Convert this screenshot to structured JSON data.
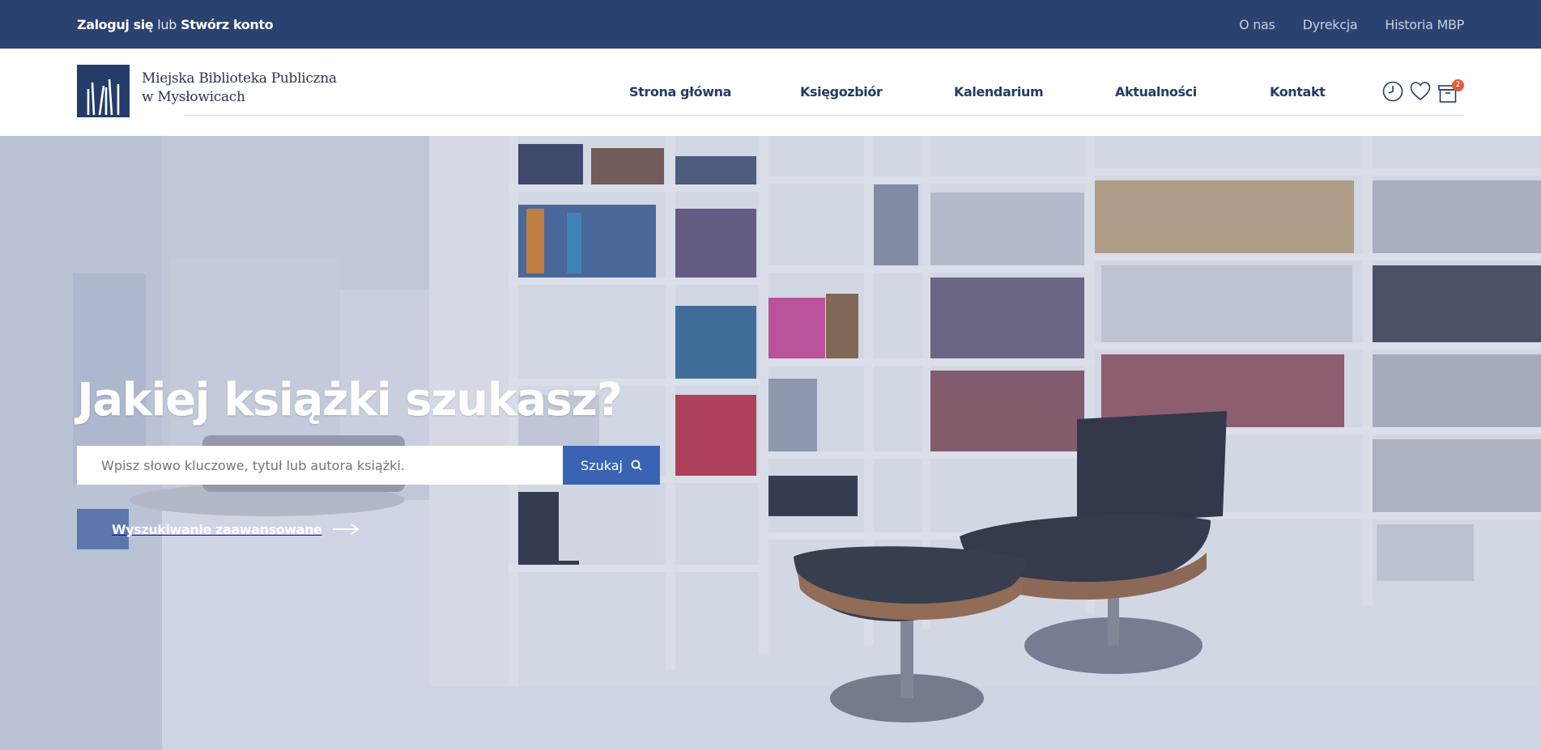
{
  "topbar": {
    "login": "Zaloguj się",
    "or": "lub",
    "register": "Stwórz konto",
    "links": [
      "O nas",
      "Dyrekcja",
      "Historia MBP"
    ]
  },
  "header": {
    "logo_line1": "Miejska Biblioteka Publiczna",
    "logo_line2": "w Mysłowicach",
    "nav": [
      "Strona główna",
      "Księgozbiór",
      "Kalendarium",
      "Aktualności",
      "Kontakt"
    ],
    "icons": [
      "clock-icon",
      "heart-icon",
      "box-icon"
    ],
    "cart_count": "2"
  },
  "hero": {
    "title": "Jakiej książki szukasz?",
    "search_placeholder": "Wpisz słowo kluczowe, tytuł lub autora książki.",
    "search_button": "Szukaj",
    "advanced_search": "Wyszukiwanie zaawansowane"
  },
  "colors": {
    "topbar": "#2b4170",
    "brand": "#233c68",
    "accent": "#3a63b3",
    "badge": "#e25c3c"
  }
}
